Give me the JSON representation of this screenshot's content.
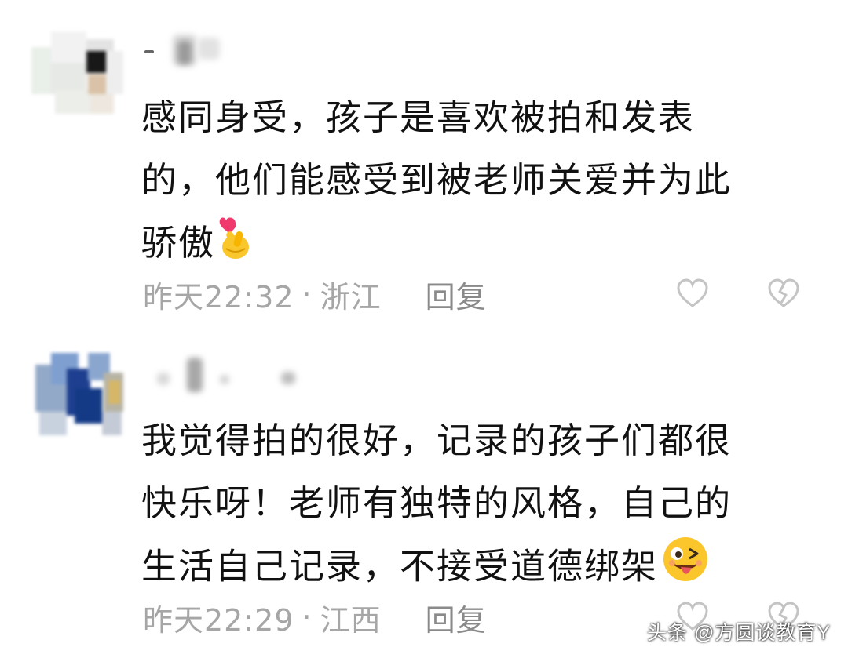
{
  "comments": [
    {
      "text_lines": [
        "感同身受，孩子是喜欢被拍和发表",
        "的，他们能感受到被老师关爱并为此",
        "骄傲"
      ],
      "emoji": "finger-heart-emoji",
      "time": "昨天22:32",
      "separator": "·",
      "location": "浙江",
      "reply_label": "回复"
    },
    {
      "text_lines": [
        "我觉得拍的很好，记录的孩子们都很",
        "快乐呀！老师有独特的风格，自己的",
        "生活自己记录，不接受道德绑架"
      ],
      "emoji": "winking-tongue-face-emoji",
      "time": "昨天22:29",
      "separator": "·",
      "location": "江西",
      "reply_label": "回复"
    }
  ],
  "icons": {
    "like": "heart-outline-icon",
    "dislike": "broken-heart-icon"
  },
  "watermark": "头条 @方圆谈教育Y",
  "colors": {
    "text": "#111111",
    "meta": "#a6a6a6",
    "icon": "#c4c4c4"
  }
}
